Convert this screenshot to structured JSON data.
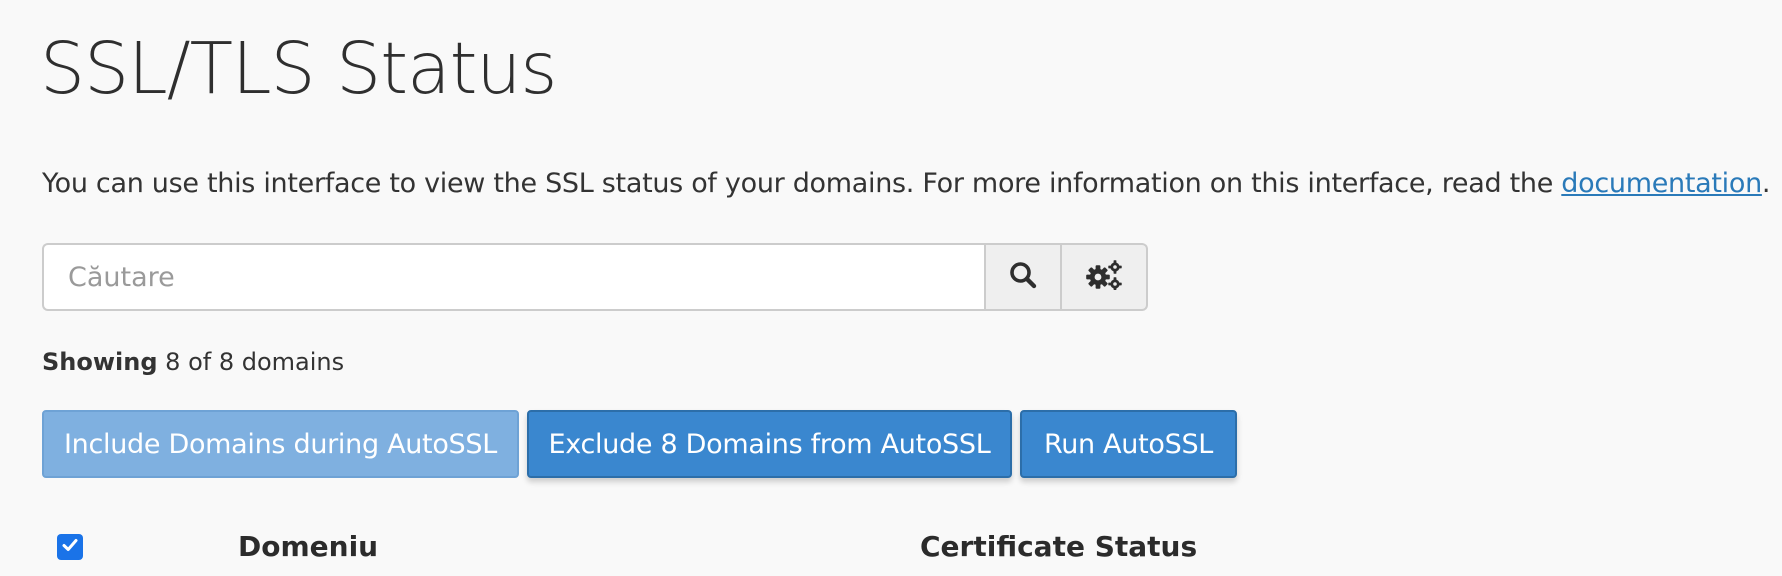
{
  "page": {
    "title": "SSL/TLS Status",
    "description_prefix": "You can use this interface to view the SSL status of your domains. For more information on this interface, read the ",
    "documentation_link": "documentation",
    "description_suffix": "."
  },
  "search": {
    "placeholder": "Căutare",
    "value": "",
    "search_icon": "search-icon",
    "settings_icon": "gears-icon"
  },
  "summary": {
    "showing_label": "Showing",
    "showing_text": "8 of 8 domains"
  },
  "actions": {
    "include_label": "Include Domains during AutoSSL",
    "exclude_label": "Exclude 8 Domains from AutoSSL",
    "run_label": "Run AutoSSL"
  },
  "table": {
    "select_all_checked": true,
    "columns": [
      "Domeniu",
      "Certificate Status"
    ]
  },
  "colors": {
    "primary_button": "#3a87cf",
    "disabled_button": "#7fb0e0",
    "link": "#2a7ab9",
    "checkbox": "#1a73e8"
  }
}
